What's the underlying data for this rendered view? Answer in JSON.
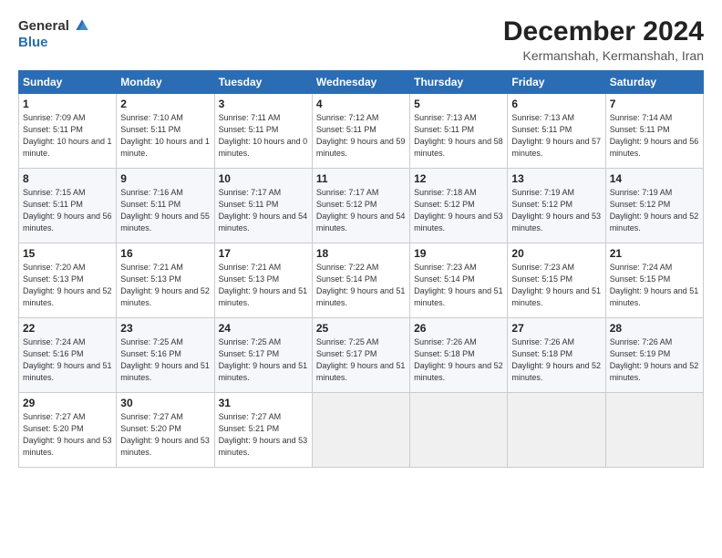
{
  "logo": {
    "general": "General",
    "blue": "Blue"
  },
  "header": {
    "month": "December 2024",
    "location": "Kermanshah, Kermanshah, Iran"
  },
  "weekdays": [
    "Sunday",
    "Monday",
    "Tuesday",
    "Wednesday",
    "Thursday",
    "Friday",
    "Saturday"
  ],
  "weeks": [
    [
      {
        "day": "1",
        "sunrise": "Sunrise: 7:09 AM",
        "sunset": "Sunset: 5:11 PM",
        "daylight": "Daylight: 10 hours and 1 minute."
      },
      {
        "day": "2",
        "sunrise": "Sunrise: 7:10 AM",
        "sunset": "Sunset: 5:11 PM",
        "daylight": "Daylight: 10 hours and 1 minute."
      },
      {
        "day": "3",
        "sunrise": "Sunrise: 7:11 AM",
        "sunset": "Sunset: 5:11 PM",
        "daylight": "Daylight: 10 hours and 0 minutes."
      },
      {
        "day": "4",
        "sunrise": "Sunrise: 7:12 AM",
        "sunset": "Sunset: 5:11 PM",
        "daylight": "Daylight: 9 hours and 59 minutes."
      },
      {
        "day": "5",
        "sunrise": "Sunrise: 7:13 AM",
        "sunset": "Sunset: 5:11 PM",
        "daylight": "Daylight: 9 hours and 58 minutes."
      },
      {
        "day": "6",
        "sunrise": "Sunrise: 7:13 AM",
        "sunset": "Sunset: 5:11 PM",
        "daylight": "Daylight: 9 hours and 57 minutes."
      },
      {
        "day": "7",
        "sunrise": "Sunrise: 7:14 AM",
        "sunset": "Sunset: 5:11 PM",
        "daylight": "Daylight: 9 hours and 56 minutes."
      }
    ],
    [
      {
        "day": "8",
        "sunrise": "Sunrise: 7:15 AM",
        "sunset": "Sunset: 5:11 PM",
        "daylight": "Daylight: 9 hours and 56 minutes."
      },
      {
        "day": "9",
        "sunrise": "Sunrise: 7:16 AM",
        "sunset": "Sunset: 5:11 PM",
        "daylight": "Daylight: 9 hours and 55 minutes."
      },
      {
        "day": "10",
        "sunrise": "Sunrise: 7:17 AM",
        "sunset": "Sunset: 5:11 PM",
        "daylight": "Daylight: 9 hours and 54 minutes."
      },
      {
        "day": "11",
        "sunrise": "Sunrise: 7:17 AM",
        "sunset": "Sunset: 5:12 PM",
        "daylight": "Daylight: 9 hours and 54 minutes."
      },
      {
        "day": "12",
        "sunrise": "Sunrise: 7:18 AM",
        "sunset": "Sunset: 5:12 PM",
        "daylight": "Daylight: 9 hours and 53 minutes."
      },
      {
        "day": "13",
        "sunrise": "Sunrise: 7:19 AM",
        "sunset": "Sunset: 5:12 PM",
        "daylight": "Daylight: 9 hours and 53 minutes."
      },
      {
        "day": "14",
        "sunrise": "Sunrise: 7:19 AM",
        "sunset": "Sunset: 5:12 PM",
        "daylight": "Daylight: 9 hours and 52 minutes."
      }
    ],
    [
      {
        "day": "15",
        "sunrise": "Sunrise: 7:20 AM",
        "sunset": "Sunset: 5:13 PM",
        "daylight": "Daylight: 9 hours and 52 minutes."
      },
      {
        "day": "16",
        "sunrise": "Sunrise: 7:21 AM",
        "sunset": "Sunset: 5:13 PM",
        "daylight": "Daylight: 9 hours and 52 minutes."
      },
      {
        "day": "17",
        "sunrise": "Sunrise: 7:21 AM",
        "sunset": "Sunset: 5:13 PM",
        "daylight": "Daylight: 9 hours and 51 minutes."
      },
      {
        "day": "18",
        "sunrise": "Sunrise: 7:22 AM",
        "sunset": "Sunset: 5:14 PM",
        "daylight": "Daylight: 9 hours and 51 minutes."
      },
      {
        "day": "19",
        "sunrise": "Sunrise: 7:23 AM",
        "sunset": "Sunset: 5:14 PM",
        "daylight": "Daylight: 9 hours and 51 minutes."
      },
      {
        "day": "20",
        "sunrise": "Sunrise: 7:23 AM",
        "sunset": "Sunset: 5:15 PM",
        "daylight": "Daylight: 9 hours and 51 minutes."
      },
      {
        "day": "21",
        "sunrise": "Sunrise: 7:24 AM",
        "sunset": "Sunset: 5:15 PM",
        "daylight": "Daylight: 9 hours and 51 minutes."
      }
    ],
    [
      {
        "day": "22",
        "sunrise": "Sunrise: 7:24 AM",
        "sunset": "Sunset: 5:16 PM",
        "daylight": "Daylight: 9 hours and 51 minutes."
      },
      {
        "day": "23",
        "sunrise": "Sunrise: 7:25 AM",
        "sunset": "Sunset: 5:16 PM",
        "daylight": "Daylight: 9 hours and 51 minutes."
      },
      {
        "day": "24",
        "sunrise": "Sunrise: 7:25 AM",
        "sunset": "Sunset: 5:17 PM",
        "daylight": "Daylight: 9 hours and 51 minutes."
      },
      {
        "day": "25",
        "sunrise": "Sunrise: 7:25 AM",
        "sunset": "Sunset: 5:17 PM",
        "daylight": "Daylight: 9 hours and 51 minutes."
      },
      {
        "day": "26",
        "sunrise": "Sunrise: 7:26 AM",
        "sunset": "Sunset: 5:18 PM",
        "daylight": "Daylight: 9 hours and 52 minutes."
      },
      {
        "day": "27",
        "sunrise": "Sunrise: 7:26 AM",
        "sunset": "Sunset: 5:18 PM",
        "daylight": "Daylight: 9 hours and 52 minutes."
      },
      {
        "day": "28",
        "sunrise": "Sunrise: 7:26 AM",
        "sunset": "Sunset: 5:19 PM",
        "daylight": "Daylight: 9 hours and 52 minutes."
      }
    ],
    [
      {
        "day": "29",
        "sunrise": "Sunrise: 7:27 AM",
        "sunset": "Sunset: 5:20 PM",
        "daylight": "Daylight: 9 hours and 53 minutes."
      },
      {
        "day": "30",
        "sunrise": "Sunrise: 7:27 AM",
        "sunset": "Sunset: 5:20 PM",
        "daylight": "Daylight: 9 hours and 53 minutes."
      },
      {
        "day": "31",
        "sunrise": "Sunrise: 7:27 AM",
        "sunset": "Sunset: 5:21 PM",
        "daylight": "Daylight: 9 hours and 53 minutes."
      },
      null,
      null,
      null,
      null
    ]
  ]
}
